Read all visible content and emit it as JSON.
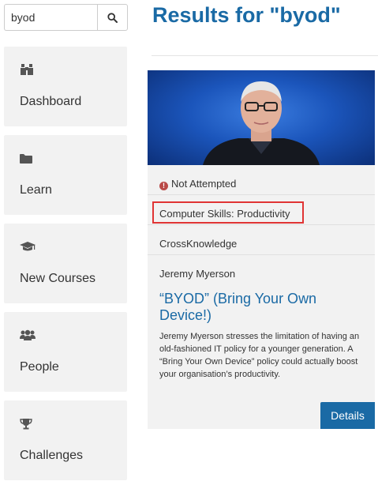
{
  "search": {
    "value": "byod",
    "icon": "search-icon"
  },
  "sidebar": {
    "items": [
      {
        "label": "Dashboard",
        "icon": "binoculars-icon"
      },
      {
        "label": "Learn",
        "icon": "folder-icon"
      },
      {
        "label": "New Courses",
        "icon": "graduation-cap-icon"
      },
      {
        "label": "People",
        "icon": "users-icon"
      },
      {
        "label": "Challenges",
        "icon": "trophy-icon"
      }
    ]
  },
  "main": {
    "title": "Results for \"byod\""
  },
  "result": {
    "status": "Not Attempted",
    "category": "Computer Skills: Productivity",
    "provider": "CrossKnowledge",
    "author": "Jeremy Myerson",
    "title": "“BYOD” (Bring Your Own Device!)",
    "description": "Jeremy Myerson stresses the limitation of having an old-fashioned IT policy for a younger generation. A “Bring Your Own Device” policy could actually boost your organisation’s productivity.",
    "details_label": "Details"
  },
  "colors": {
    "accent": "#1a6aa5",
    "highlight": "#e03434",
    "status": "#b94a48"
  }
}
